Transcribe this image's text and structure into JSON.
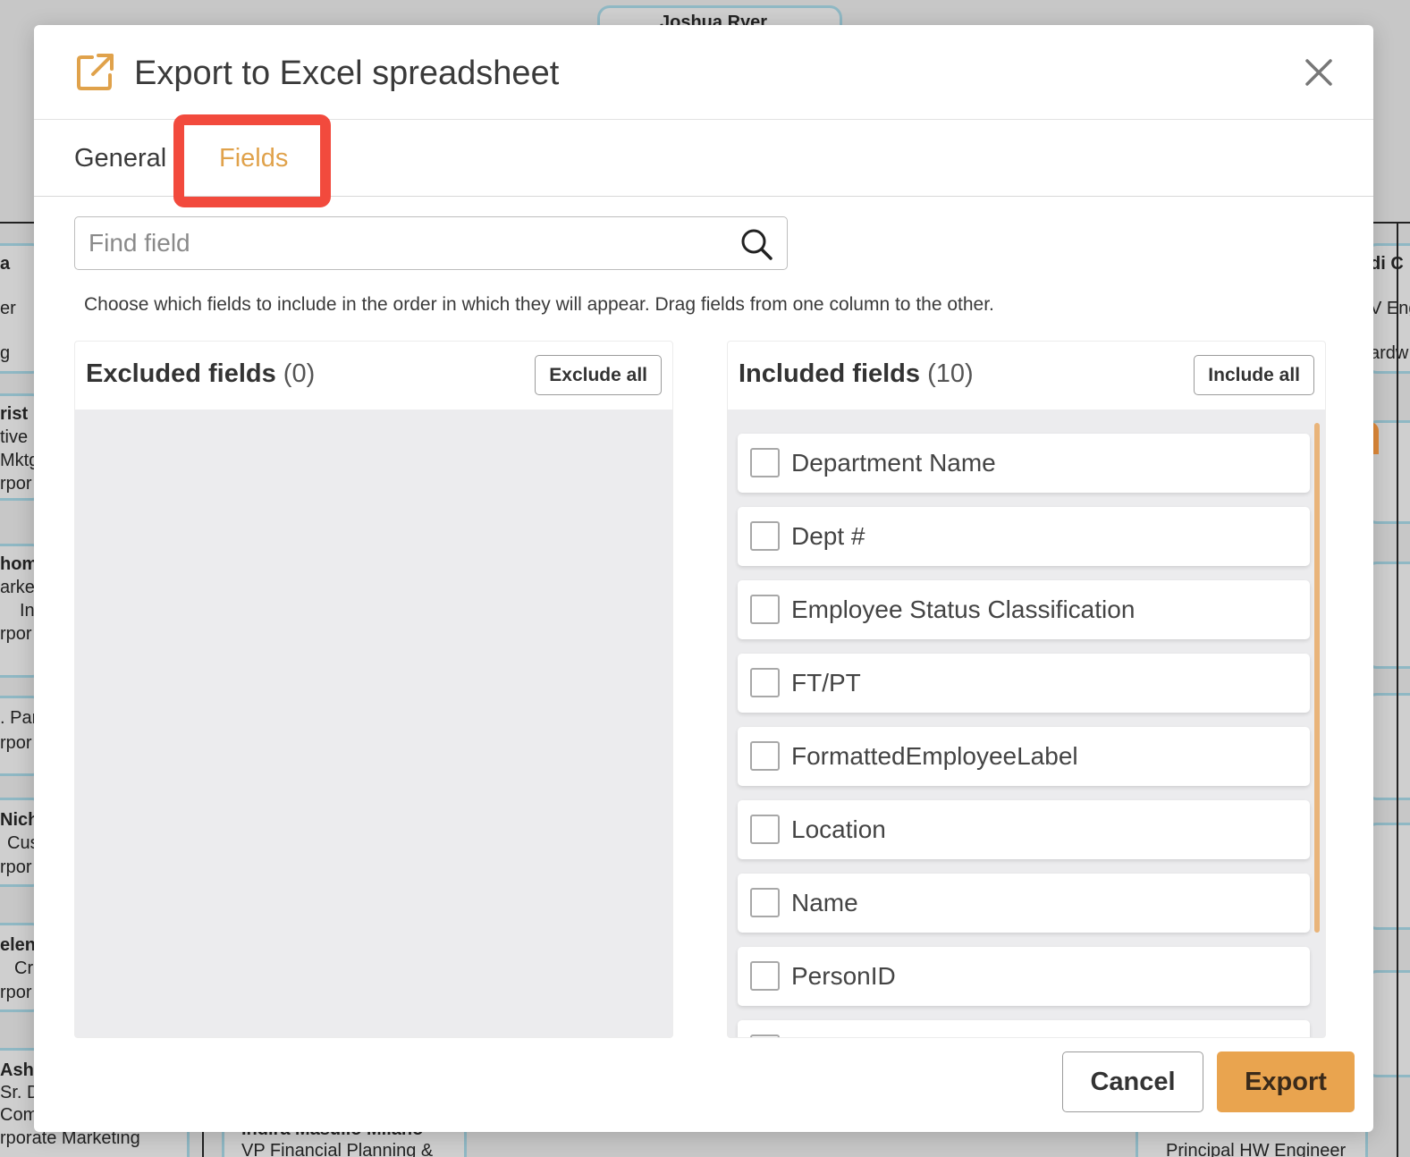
{
  "background": {
    "texts": [
      "Joshua Ryer",
      "a",
      "er",
      "g",
      "rist",
      "tive",
      "Mktg",
      "rpor",
      "hom",
      "arket",
      "In",
      "rpor",
      ". Par",
      "rpor",
      "Nich",
      "Cus",
      "rpor",
      "elen",
      "Cr",
      "rpor",
      "Ashi",
      "Sr. Di",
      "Com",
      "rporate Marketing",
      "Indira Masullo Milano",
      "VP Financial Planning &",
      "di C",
      "V Eng",
      "ardw",
      "Principal HW Engineer"
    ]
  },
  "modal": {
    "title": "Export to Excel spreadsheet",
    "tabs": [
      {
        "label": "General",
        "active": false
      },
      {
        "label": "Fields",
        "active": true
      }
    ],
    "search": {
      "placeholder": "Find field",
      "value": ""
    },
    "instructions": "Choose which fields to include in the order in which they will appear. Drag fields from one column to the other.",
    "excluded": {
      "title": "Excluded fields",
      "count": "(0)",
      "button": "Exclude all",
      "fields": []
    },
    "included": {
      "title": "Included fields",
      "count": "(10)",
      "button": "Include all",
      "fields": [
        "Department Name",
        "Dept #",
        "Employee Status Classification",
        "FT/PT",
        "FormattedEmployeeLabel",
        "Location",
        "Name",
        "PersonID"
      ]
    },
    "footer": {
      "cancel": "Cancel",
      "export": "Export"
    }
  },
  "colors": {
    "accent": "#e0a24b",
    "export_button": "#e9a44f",
    "highlight": "#f24a3d",
    "scrollbar": "#e9b47a",
    "icons": [
      "export-icon",
      "close-icon",
      "search-icon"
    ]
  }
}
